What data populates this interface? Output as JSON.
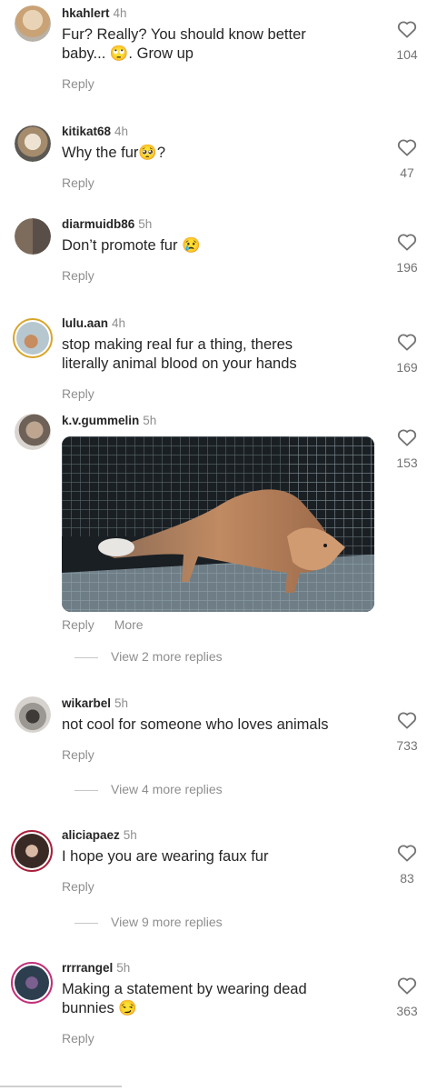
{
  "comments": [
    {
      "username": "hkahlert",
      "time": "4h",
      "text": "Fur? Really? You should know better baby... 🙄. Grow up",
      "reply_label": "Reply",
      "likes": "104"
    },
    {
      "username": "kitikat68",
      "time": "4h",
      "text": "Why the fur🥺?",
      "reply_label": "Reply",
      "likes": "47"
    },
    {
      "username": "diarmuidb86",
      "time": "5h",
      "text": "Don’t promote fur 😢",
      "reply_label": "Reply",
      "likes": "196"
    },
    {
      "username": "lulu.aan",
      "time": "4h",
      "text": "stop making real fur a thing, theres literally animal blood on your hands",
      "reply_label": "Reply",
      "likes": "169"
    },
    {
      "username": "k.v.gummelin",
      "time": "5h",
      "text": "",
      "reply_label": "Reply",
      "more_label": "More",
      "likes": "153",
      "view_replies": "View 2 more replies"
    },
    {
      "username": "wikarbel",
      "time": "5h",
      "text": "not cool for someone who loves animals",
      "reply_label": "Reply",
      "likes": "733",
      "view_replies": "View 4 more replies"
    },
    {
      "username": "aliciapaez",
      "time": "5h",
      "text": "I hope you are wearing faux fur",
      "reply_label": "Reply",
      "likes": "83",
      "view_replies": "View 9 more replies"
    },
    {
      "username": "rrrrangel",
      "time": "5h",
      "text": "Making a statement by wearing dead bunnies 😏",
      "reply_label": "Reply",
      "likes": "363"
    }
  ],
  "icons": {
    "like": "heart-outline-icon"
  },
  "colors": {
    "text": "#262626",
    "secondary": "#8e8e8e",
    "story_ring": "#d8a52b"
  }
}
